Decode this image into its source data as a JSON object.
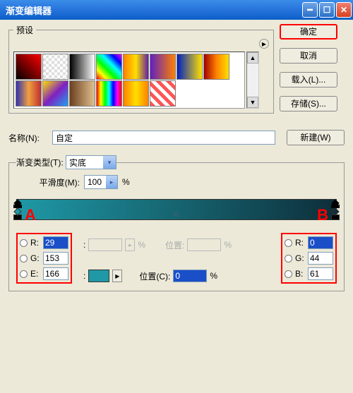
{
  "window": {
    "title": "渐变编辑器"
  },
  "presets": {
    "legend": "预设"
  },
  "side": {
    "ok": "确定",
    "cancel": "取消",
    "load": "载入(L)...",
    "save": "存储(S)..."
  },
  "name": {
    "label": "名称(N):",
    "value": "自定",
    "new": "新建(W)"
  },
  "type": {
    "legend": "渐变类型(T):",
    "value": "实底",
    "smooth_label": "平滑度(M):",
    "smooth_value": "100",
    "percent": "%"
  },
  "markers": {
    "A": "A",
    "B": "B"
  },
  "left_rgb": {
    "R_label": "R:",
    "R": "29",
    "G_label": "G:",
    "G": "153",
    "E_label": "E:",
    "E": "166"
  },
  "right_rgb": {
    "R_label": "R:",
    "R": "0",
    "G_label": "G:",
    "G": "44",
    "B_label": "B:",
    "B": "61"
  },
  "mid": {
    "pos1_label": "位置:",
    "colon": ":",
    "pos2_label": "位置(C):",
    "pos2_value": "0",
    "percent": "%"
  }
}
